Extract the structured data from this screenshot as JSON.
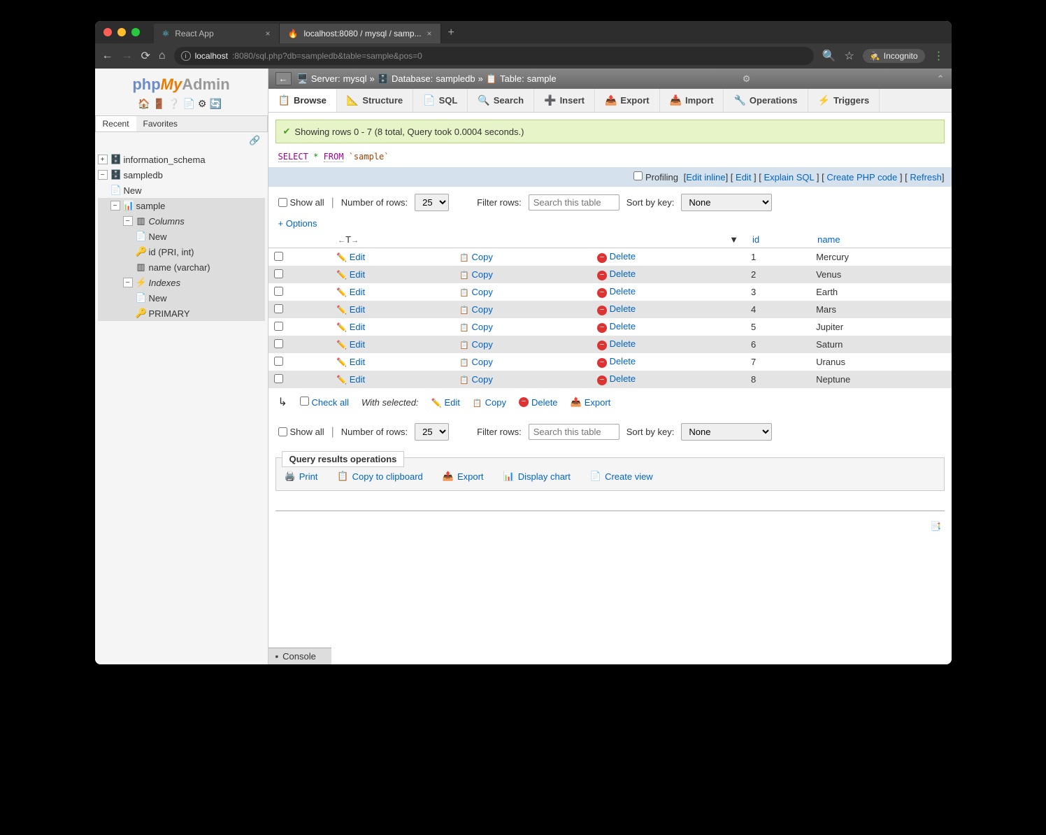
{
  "browser": {
    "tabs": [
      {
        "title": "React App",
        "icon": "⚛"
      },
      {
        "title": "localhost:8080 / mysql / samp...",
        "icon": "🔥"
      }
    ],
    "url_host": "localhost",
    "url_path": ":8080/sql.php?db=sampledb&table=sample&pos=0",
    "incognito": "Incognito"
  },
  "logo": {
    "php": "php",
    "my": "My",
    "admin": "Admin"
  },
  "sidetabs": {
    "recent": "Recent",
    "favorites": "Favorites"
  },
  "tree": {
    "info_schema": "information_schema",
    "sampledb": "sampledb",
    "new1": "New",
    "sample": "sample",
    "columns": "Columns",
    "new2": "New",
    "col_id": "id (PRI, int)",
    "col_name": "name (varchar)",
    "indexes": "Indexes",
    "new3": "New",
    "primary": "PRIMARY"
  },
  "breadcrumb": {
    "server_lbl": "Server:",
    "server": "mysql",
    "db_lbl": "Database:",
    "db": "sampledb",
    "table_lbl": "Table:",
    "table": "sample"
  },
  "toptabs": {
    "browse": "Browse",
    "structure": "Structure",
    "sql": "SQL",
    "search": "Search",
    "insert": "Insert",
    "export": "Export",
    "import": "Import",
    "operations": "Operations",
    "triggers": "Triggers"
  },
  "success": "Showing rows 0 - 7 (8 total, Query took 0.0004 seconds.)",
  "sql": {
    "select": "SELECT",
    "star": "*",
    "from": "FROM",
    "table": "`sample`"
  },
  "profiling": {
    "label": "Profiling",
    "edit_inline": "Edit inline",
    "edit": "Edit",
    "explain": "Explain SQL",
    "create_php": "Create PHP code",
    "refresh": "Refresh"
  },
  "controls": {
    "show_all": "Show all",
    "num_rows": "Number of rows:",
    "rows_value": "25",
    "filter_label": "Filter rows:",
    "filter_placeholder": "Search this table",
    "sort_label": "Sort by key:",
    "sort_value": "None"
  },
  "options": "+ Options",
  "table": {
    "headers": {
      "id": "id",
      "name": "name"
    },
    "actions": {
      "edit": "Edit",
      "copy": "Copy",
      "delete": "Delete"
    },
    "rows": [
      {
        "id": "1",
        "name": "Mercury"
      },
      {
        "id": "2",
        "name": "Venus"
      },
      {
        "id": "3",
        "name": "Earth"
      },
      {
        "id": "4",
        "name": "Mars"
      },
      {
        "id": "5",
        "name": "Jupiter"
      },
      {
        "id": "6",
        "name": "Saturn"
      },
      {
        "id": "7",
        "name": "Uranus"
      },
      {
        "id": "8",
        "name": "Neptune"
      }
    ]
  },
  "bulk": {
    "check_all": "Check all",
    "with_selected": "With selected:",
    "edit": "Edit",
    "copy": "Copy",
    "delete": "Delete",
    "export": "Export"
  },
  "qro": {
    "title": "Query results operations",
    "print": "Print",
    "clipboard": "Copy to clipboard",
    "export": "Export",
    "chart": "Display chart",
    "view": "Create view"
  },
  "console": "Console"
}
